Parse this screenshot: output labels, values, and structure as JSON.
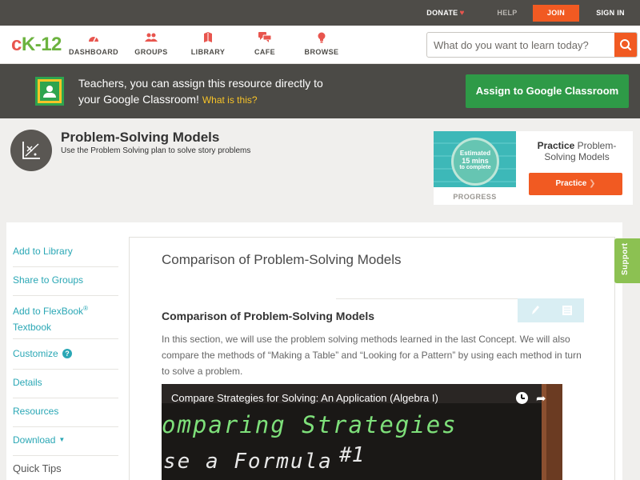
{
  "topbar": {
    "donate": "DONATE",
    "help": "HELP",
    "join": "JOIN",
    "signin": "SIGN IN"
  },
  "brand": {
    "part1": "c",
    "part2": "K",
    "part3": "-12"
  },
  "nav": {
    "dashboard": "DASHBOARD",
    "groups": "GROUPS",
    "library": "LIBRARY",
    "cafe": "CAFE",
    "browse": "BROWSE"
  },
  "search": {
    "placeholder": "What do you want to learn today?"
  },
  "classroom_banner": {
    "text_line1": "Teachers, you can assign this resource directly to",
    "text_line2": "your Google Classroom!",
    "what_link": "What is this?",
    "button": "Assign to Google Classroom"
  },
  "concept": {
    "title": "Problem-Solving Models",
    "description": "Use the Problem Solving plan to solve story problems"
  },
  "practice_card": {
    "estimated": "Estimated",
    "minutes": "15 mins",
    "to_complete": "to complete",
    "progress_label": "PROGRESS",
    "title_bold": "Practice",
    "title_rest": "Problem-Solving Models",
    "button": "Practice"
  },
  "sidebar": {
    "add_to_library": "Add to Library",
    "share_to_groups": "Share to Groups",
    "add_to_flexbook_1": "Add to FlexBook",
    "add_to_flexbook_sup": "®",
    "add_to_flexbook_2": "Textbook",
    "customize": "Customize",
    "customize_badge": "?",
    "details": "Details",
    "resources": "Resources",
    "download": "Download",
    "quick_tips": "Quick Tips"
  },
  "content": {
    "page_title": "Comparison of Problem-Solving Models",
    "section_title": "Comparison of Problem-Solving Models",
    "paragraph": "In this section, we will use the problem solving methods learned in the last Concept. We will also compare the methods of “Making a Table” and “Looking for a Pattern” by using each method in turn to solve a problem."
  },
  "video": {
    "title": "Compare Strategies for Solving: An Application (Algebra I)",
    "chalk_line1": "omparing Strategies",
    "chalk_line2": "se a Formula",
    "chalk_num": "#1"
  },
  "support_tab": "Support",
  "colors": {
    "accent_orange": "#f15a22",
    "link_teal": "#2aa7b5",
    "classroom_green": "#2e9a47",
    "support_green": "#8cc152",
    "header_dark": "#4e4c48"
  }
}
